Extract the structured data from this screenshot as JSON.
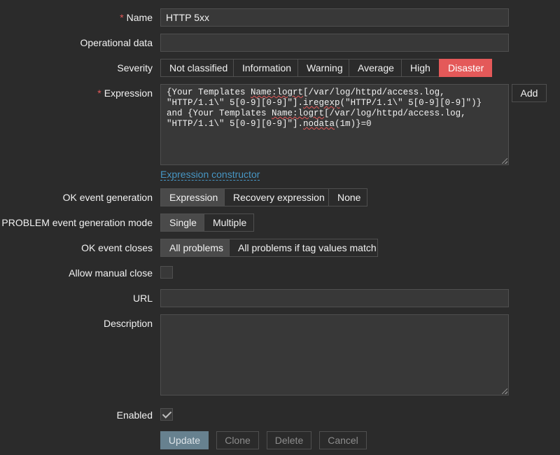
{
  "form": {
    "name": {
      "label": "Name",
      "required_mark": "*",
      "value": "HTTP 5xx"
    },
    "operational_data": {
      "label": "Operational data",
      "value": ""
    },
    "severity": {
      "label": "Severity",
      "options": [
        "Not classified",
        "Information",
        "Warning",
        "Average",
        "High",
        "Disaster"
      ],
      "selected": "Disaster",
      "selected_color": "#e45959"
    },
    "expression": {
      "label": "Expression",
      "required_mark": "*",
      "line1_a": "{Your Templates ",
      "line1_u": "Name:logrt",
      "line1_b": "[/var/log/httpd/access.log,",
      "line2_a": "\"HTTP/1.1\\\" 5[0-9][0-9]\"].",
      "line2_u": "iregexp",
      "line2_b": "(\"HTTP/1.1\\\" 5[0-9][0-9]\")}",
      "line3_a": "and {Your Templates ",
      "line3_u": "Name:logrt",
      "line3_b": "[/var/log/httpd/access.log,",
      "line4_a": "\"HTTP/1.1\\\" 5[0-9][0-9]\"].",
      "line4_u": "nodata",
      "line4_b": "(1m)}=0",
      "add_button": "Add",
      "constructor_link": "Expression constructor"
    },
    "ok_event_generation": {
      "label": "OK event generation",
      "options": [
        "Expression",
        "Recovery expression",
        "None"
      ],
      "selected": "Expression"
    },
    "problem_event_generation_mode": {
      "label": "PROBLEM event generation mode",
      "options": [
        "Single",
        "Multiple"
      ],
      "selected": "Single"
    },
    "ok_event_closes": {
      "label": "OK event closes",
      "options": [
        "All problems",
        "All problems if tag values match"
      ],
      "selected": "All problems"
    },
    "allow_manual_close": {
      "label": "Allow manual close",
      "checked": false
    },
    "url": {
      "label": "URL",
      "value": ""
    },
    "description": {
      "label": "Description",
      "value": ""
    },
    "enabled": {
      "label": "Enabled",
      "checked": true
    }
  },
  "actions": {
    "update": "Update",
    "clone": "Clone",
    "delete": "Delete",
    "cancel": "Cancel"
  }
}
